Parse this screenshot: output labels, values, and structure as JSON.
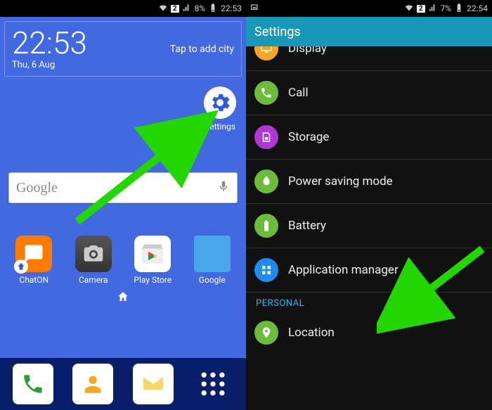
{
  "left": {
    "status": {
      "battery_pct": "8%",
      "time": "22:53",
      "sim": "2"
    },
    "clock": {
      "time": "22:53",
      "date": "Thu, 6 Aug",
      "weather_hint": "Tap to add city"
    },
    "shortcut": {
      "label": "Settings"
    },
    "search": {
      "logo": "Google"
    },
    "apps_row1": [
      {
        "label": "ChatON"
      },
      {
        "label": "Camera"
      },
      {
        "label": "Play Store"
      },
      {
        "label": "Google"
      }
    ]
  },
  "right": {
    "status": {
      "battery_pct": "7%",
      "time": "22:54",
      "sim": "2"
    },
    "title": "Settings",
    "items": [
      {
        "label": "Display",
        "color": "#f5a623"
      },
      {
        "label": "Call",
        "color": "#6dbb3c"
      },
      {
        "label": "Storage",
        "color": "#b037d6"
      },
      {
        "label": "Power saving mode",
        "color": "#6dbb3c"
      },
      {
        "label": "Battery",
        "color": "#6dbb3c"
      },
      {
        "label": "Application manager",
        "color": "#1f8def"
      }
    ],
    "section": "PERSONAL",
    "items2": [
      {
        "label": "Location",
        "color": "#6dbb3c"
      }
    ]
  }
}
